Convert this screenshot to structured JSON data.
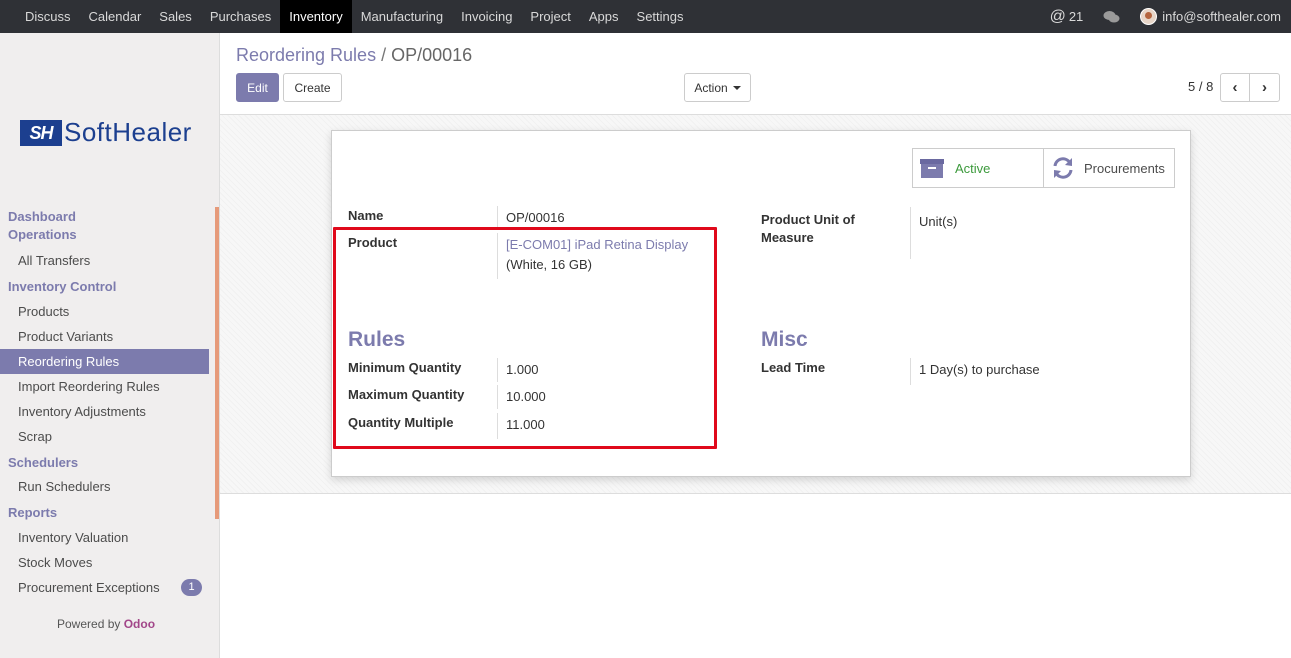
{
  "topnav": {
    "menu": [
      "Discuss",
      "Calendar",
      "Sales",
      "Purchases",
      "Inventory",
      "Manufacturing",
      "Invoicing",
      "Project",
      "Apps",
      "Settings"
    ],
    "active_index": 4,
    "mentions_count": "21",
    "user_email": "info@softhealer.com"
  },
  "logo": {
    "mark": "SH",
    "word": "SoftHealer"
  },
  "sidebar": {
    "sections": [
      {
        "title": "Dashboard Operations",
        "items": [
          "All Transfers"
        ]
      },
      {
        "title": "Inventory Control",
        "items": [
          "Products",
          "Product Variants",
          "Reordering Rules",
          "Import Reordering Rules",
          "Inventory Adjustments",
          "Scrap"
        ]
      },
      {
        "title": "Schedulers",
        "items": [
          "Run Schedulers"
        ]
      },
      {
        "title": "Reports",
        "items": [
          "Inventory Valuation",
          "Stock Moves",
          "Procurement Exceptions"
        ]
      }
    ],
    "active_item": "Reordering Rules",
    "procurement_badge": "1",
    "powered_by": "Powered by",
    "powered_brand": "Odoo"
  },
  "breadcrumb": {
    "parent": "Reordering Rules",
    "separator": "/",
    "current": "OP/00016"
  },
  "buttons": {
    "edit": "Edit",
    "create": "Create",
    "action": "Action"
  },
  "pager": {
    "value": "5 / 8"
  },
  "stat_buttons": {
    "active": "Active",
    "procurements": "Procurements"
  },
  "form": {
    "name_label": "Name",
    "name_value": "OP/00016",
    "product_label": "Product",
    "product_link": "[E-COM01] iPad Retina Display",
    "product_variant": "(White, 16 GB)",
    "uom_label_line1": "Product Unit of",
    "uom_label_line2": "Measure",
    "uom_value": "Unit(s)",
    "rules_title": "Rules",
    "min_label": "Minimum Quantity",
    "min_value": "1.000",
    "max_label": "Maximum Quantity",
    "max_value": "10.000",
    "multiple_label": "Quantity Multiple",
    "multiple_value": "11.000",
    "misc_title": "Misc",
    "lead_label": "Lead Time",
    "lead_value": "1 Day(s) to purchase"
  },
  "colors": {
    "brand": "#7c7bad",
    "topbar": "#2f3136",
    "highlight": "#e0091b",
    "active_green": "#3c9a3c"
  }
}
